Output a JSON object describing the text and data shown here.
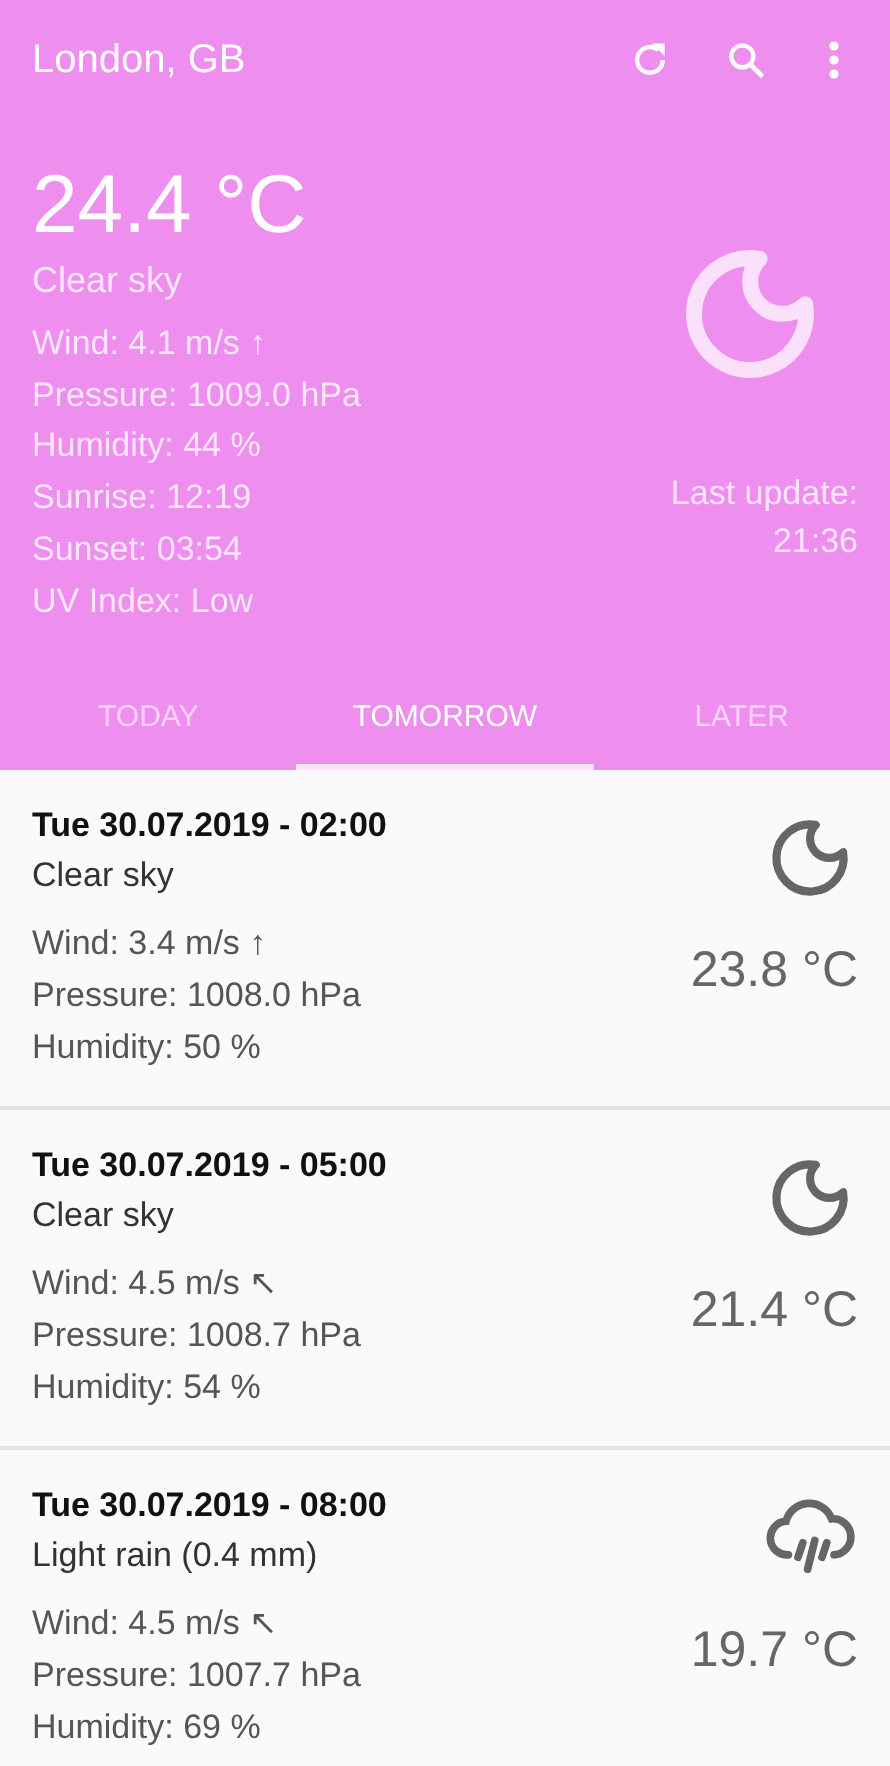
{
  "app_bar": {
    "title": "London, GB"
  },
  "current": {
    "temperature": "24.4 °C",
    "description": "Clear sky",
    "kind": "moon",
    "details": [
      "Wind: 4.1 m/s ↑",
      "Pressure: 1009.0 hPa",
      "Humidity: 44 %",
      "Sunrise: 12:19",
      "Sunset: 03:54",
      "UV Index: Low"
    ],
    "last_update_label": "Last update:",
    "last_update_time": "21:36"
  },
  "tabs": [
    {
      "label": "TODAY",
      "selected": false
    },
    {
      "label": "TOMORROW",
      "selected": true
    },
    {
      "label": "LATER",
      "selected": false
    }
  ],
  "forecast": [
    {
      "datetime": "Tue 30.07.2019 - 02:00",
      "description": "Clear sky",
      "wind": "Wind: 3.4 m/s ↑",
      "pressure": "Pressure: 1008.0 hPa",
      "humidity": "Humidity: 50 %",
      "temperature": "23.8 °C",
      "kind": "moon"
    },
    {
      "datetime": "Tue 30.07.2019 - 05:00",
      "description": "Clear sky",
      "wind": "Wind: 4.5 m/s ↖",
      "pressure": "Pressure: 1008.7 hPa",
      "humidity": "Humidity: 54 %",
      "temperature": "21.4 °C",
      "kind": "moon"
    },
    {
      "datetime": "Tue 30.07.2019 - 08:00",
      "description": "Light rain (0.4 mm)",
      "wind": "Wind: 4.5 m/s ↖",
      "pressure": "Pressure: 1007.7 hPa",
      "humidity": "Humidity: 69 %",
      "temperature": "19.7 °C",
      "kind": "rain"
    }
  ]
}
